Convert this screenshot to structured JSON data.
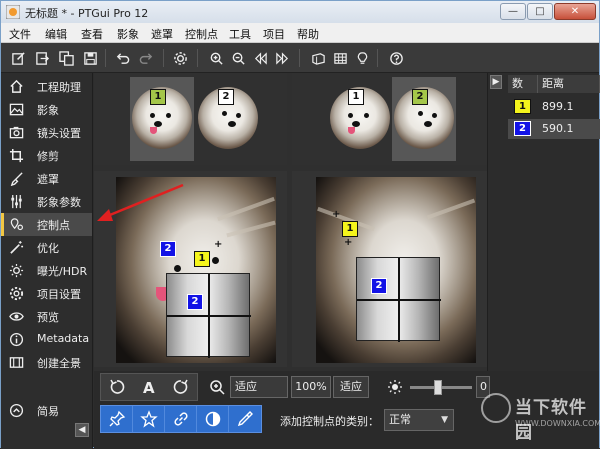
{
  "window": {
    "title": "无标题 * - PTGui Pro 12",
    "minimize_glyph": "—",
    "maximize_glyph": "□",
    "close_glyph": "✕"
  },
  "menu": [
    "文件",
    "编辑",
    "查看",
    "影象",
    "遮罩",
    "控制点",
    "工具",
    "项目",
    "帮助"
  ],
  "toolbar_icons": [
    "edit-icon",
    "export-icon",
    "copy-icon",
    "save-icon",
    "undo-icon",
    "redo-icon",
    "settings-icon",
    "zoom-in-icon",
    "zoom-out-icon",
    "prev-icon",
    "next-icon",
    "panorama-icon",
    "grid-icon",
    "bulb-icon",
    "help-icon"
  ],
  "sidebar": {
    "items": [
      {
        "label": "工程助理",
        "icon": "home-icon"
      },
      {
        "label": "影象",
        "icon": "image-icon"
      },
      {
        "label": "镜头设置",
        "icon": "camera-icon"
      },
      {
        "label": "修剪",
        "icon": "crop-icon"
      },
      {
        "label": "遮罩",
        "icon": "brush-icon"
      },
      {
        "label": "影象参数",
        "icon": "sliders-icon"
      },
      {
        "label": "控制点",
        "icon": "pin-icon"
      },
      {
        "label": "优化",
        "icon": "wand-icon"
      },
      {
        "label": "曝光/HDR",
        "icon": "sun-icon"
      },
      {
        "label": "项目设置",
        "icon": "gear-icon"
      },
      {
        "label": "预览",
        "icon": "eye-icon"
      },
      {
        "label": "Metadata",
        "icon": "info-icon"
      },
      {
        "label": "创建全景",
        "icon": "film-icon"
      }
    ],
    "active_index": 6,
    "simple_mode_label": "简易",
    "collapse_glyph": "◀"
  },
  "left_strip": {
    "thumbs": [
      {
        "badge": "1",
        "badge_color": "green",
        "selected": true
      },
      {
        "badge": "2",
        "badge_color": "white",
        "selected": false
      }
    ]
  },
  "right_strip": {
    "thumbs": [
      {
        "badge": "1",
        "badge_color": "white",
        "selected": false
      },
      {
        "badge": "2",
        "badge_color": "green",
        "selected": true
      }
    ]
  },
  "left_panel": {
    "points": [
      {
        "label": "2",
        "color": "blue"
      },
      {
        "label": "1",
        "color": "yellow"
      }
    ],
    "loupe_label": "2"
  },
  "right_panel": {
    "points": [
      {
        "label": "1",
        "color": "yellow"
      }
    ],
    "loupe_label": "2"
  },
  "bottom": {
    "zoom_value": "适应",
    "zoom_percent": "100%",
    "fit_label": "适应",
    "slider_value": "0",
    "cp_type_label": "添加控制点的类别：",
    "cp_type_value": "正常"
  },
  "right_table": {
    "expand_glyph": "▶",
    "col_num": "数",
    "col_dist": "距离",
    "rows": [
      {
        "num": "1",
        "color": "yellow",
        "dist": "899.1"
      },
      {
        "num": "2",
        "color": "blue",
        "dist": "590.1"
      }
    ]
  },
  "watermark": {
    "text": "当下软件园",
    "sub": "WWW.DOWNXIA.COM"
  },
  "colors": {
    "accent": "#f2c744",
    "blue_button": "#2f6fce",
    "arrow": "#e02020"
  }
}
